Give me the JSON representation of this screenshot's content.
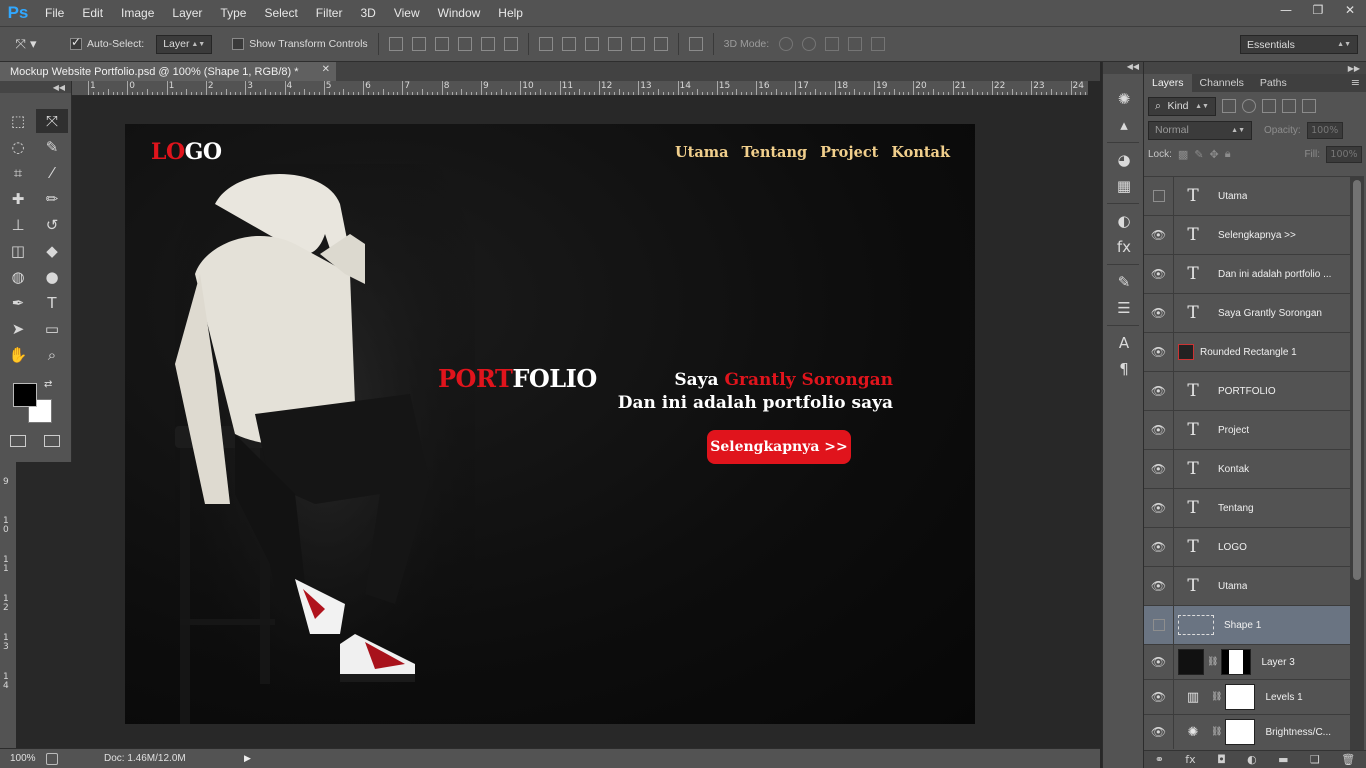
{
  "app": {
    "logo": "Ps"
  },
  "menu": [
    "File",
    "Edit",
    "Image",
    "Layer",
    "Type",
    "Select",
    "Filter",
    "3D",
    "View",
    "Window",
    "Help"
  ],
  "window_buttons": [
    "—",
    "❐",
    "✕"
  ],
  "options": {
    "auto_select_label": "Auto-Select:",
    "auto_select_value": "Layer",
    "transform_label": "Show Transform Controls",
    "mode3d_label": "3D Mode:",
    "workspace": "Essentials"
  },
  "document": {
    "tab_title": "Mockup Website Portfolio.psd @ 100% (Shape 1, RGB/8) *",
    "zoom": "100%",
    "doc_info": "Doc: 1.46M/12.0M"
  },
  "ruler": {
    "h_labels": [
      "1",
      "0",
      "1",
      "2",
      "3",
      "4",
      "5",
      "6",
      "7",
      "8",
      "9",
      "10",
      "11",
      "12",
      "13",
      "14",
      "15",
      "16",
      "17",
      "18",
      "19",
      "20",
      "21",
      "22",
      "23",
      "24"
    ],
    "v_labels": [
      "9",
      "1 0",
      "1 1",
      "1 2",
      "1 3",
      "1 4"
    ]
  },
  "site": {
    "logo_red": "LO",
    "logo_white": "GO",
    "nav": [
      "Utama",
      "Tentang",
      "Project",
      "Kontak"
    ],
    "title_red": "PORT",
    "title_white": "FOLIO",
    "intro_line1_white": "Saya ",
    "intro_line1_red": "Grantly Sorongan",
    "intro_line2": "Dan ini adalah portfolio saya",
    "cta": "Selengkapnya >>"
  },
  "layers_panel": {
    "tabs": [
      "Layers",
      "Channels",
      "Paths"
    ],
    "filter": "Kind",
    "blend_mode": "Normal",
    "opacity_label": "Opacity:",
    "opacity": "100%",
    "lock_label": "Lock:",
    "fill_label": "Fill:",
    "fill": "100%",
    "layers": [
      {
        "name": "Utama",
        "type": "text",
        "visible": false
      },
      {
        "name": "Selengkapnya >>",
        "type": "text",
        "visible": true
      },
      {
        "name": "Dan ini adalah portfolio ...",
        "type": "text",
        "visible": true
      },
      {
        "name": "Saya Grantly Sorongan",
        "type": "text",
        "visible": true
      },
      {
        "name": "Rounded Rectangle 1",
        "type": "shape",
        "visible": true
      },
      {
        "name": "PORTFOLIO",
        "type": "text",
        "visible": true
      },
      {
        "name": "Project",
        "type": "text",
        "visible": true
      },
      {
        "name": "Kontak",
        "type": "text",
        "visible": true
      },
      {
        "name": "Tentang",
        "type": "text",
        "visible": true
      },
      {
        "name": "LOGO",
        "type": "text",
        "visible": true
      },
      {
        "name": "Utama",
        "type": "text",
        "visible": true
      },
      {
        "name": "Shape 1",
        "type": "shape-box",
        "visible": false,
        "selected": true
      },
      {
        "name": "Layer 3",
        "type": "image",
        "visible": true
      },
      {
        "name": "Levels 1",
        "type": "adjust",
        "visible": true
      },
      {
        "name": "Brightness/C...",
        "type": "adjust",
        "visible": true
      }
    ]
  },
  "colors": {
    "accent_red": "#e0141c",
    "nav_gold": "#f1cf8c",
    "selection": "#6a7482"
  }
}
